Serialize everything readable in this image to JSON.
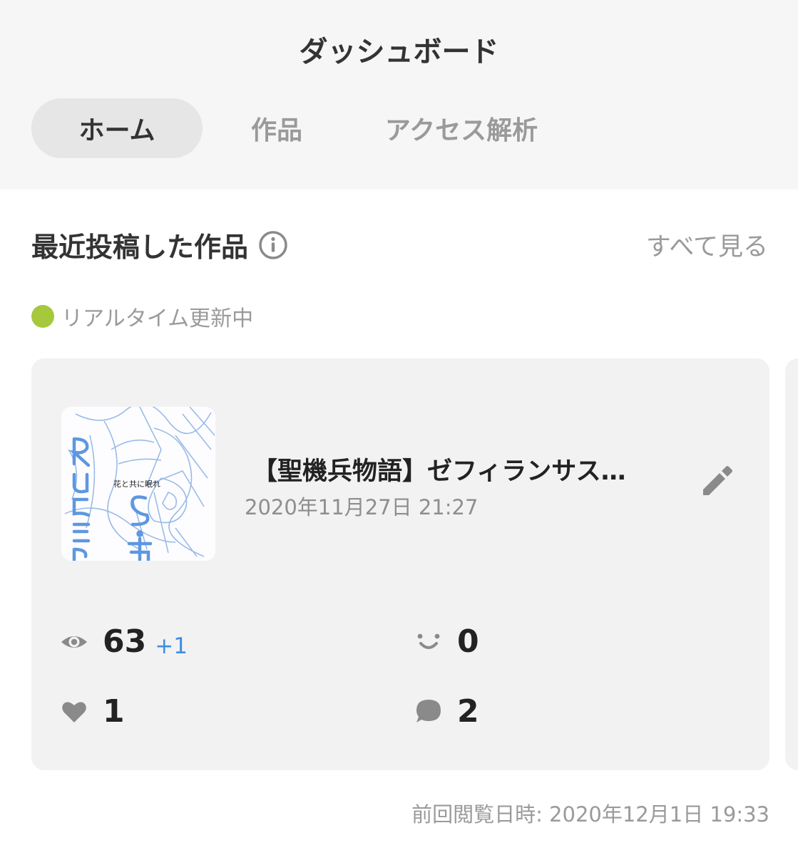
{
  "header": {
    "title": "ダッシュボード",
    "tabs": [
      {
        "label": "ホーム",
        "active": true
      },
      {
        "label": "作品",
        "active": false
      },
      {
        "label": "アクセス解析",
        "active": false
      }
    ]
  },
  "section": {
    "title": "最近投稿した作品",
    "info_icon": "info-icon",
    "see_all": "すべて見る",
    "realtime_label": "リアルタイム更新中",
    "realtime_color": "#a5c83d"
  },
  "work": {
    "title": "【聖機兵物語】ゼフィランサス…",
    "date": "2020年11月27日 21:27",
    "thumbnail_text": "花と共に眠れ",
    "stats": {
      "views": "63",
      "views_delta": "+1",
      "reactions": "0",
      "likes": "1",
      "comments": "2"
    }
  },
  "footer": {
    "last_viewed": "前回閲覧日時: 2020年12月1日 19:33"
  }
}
